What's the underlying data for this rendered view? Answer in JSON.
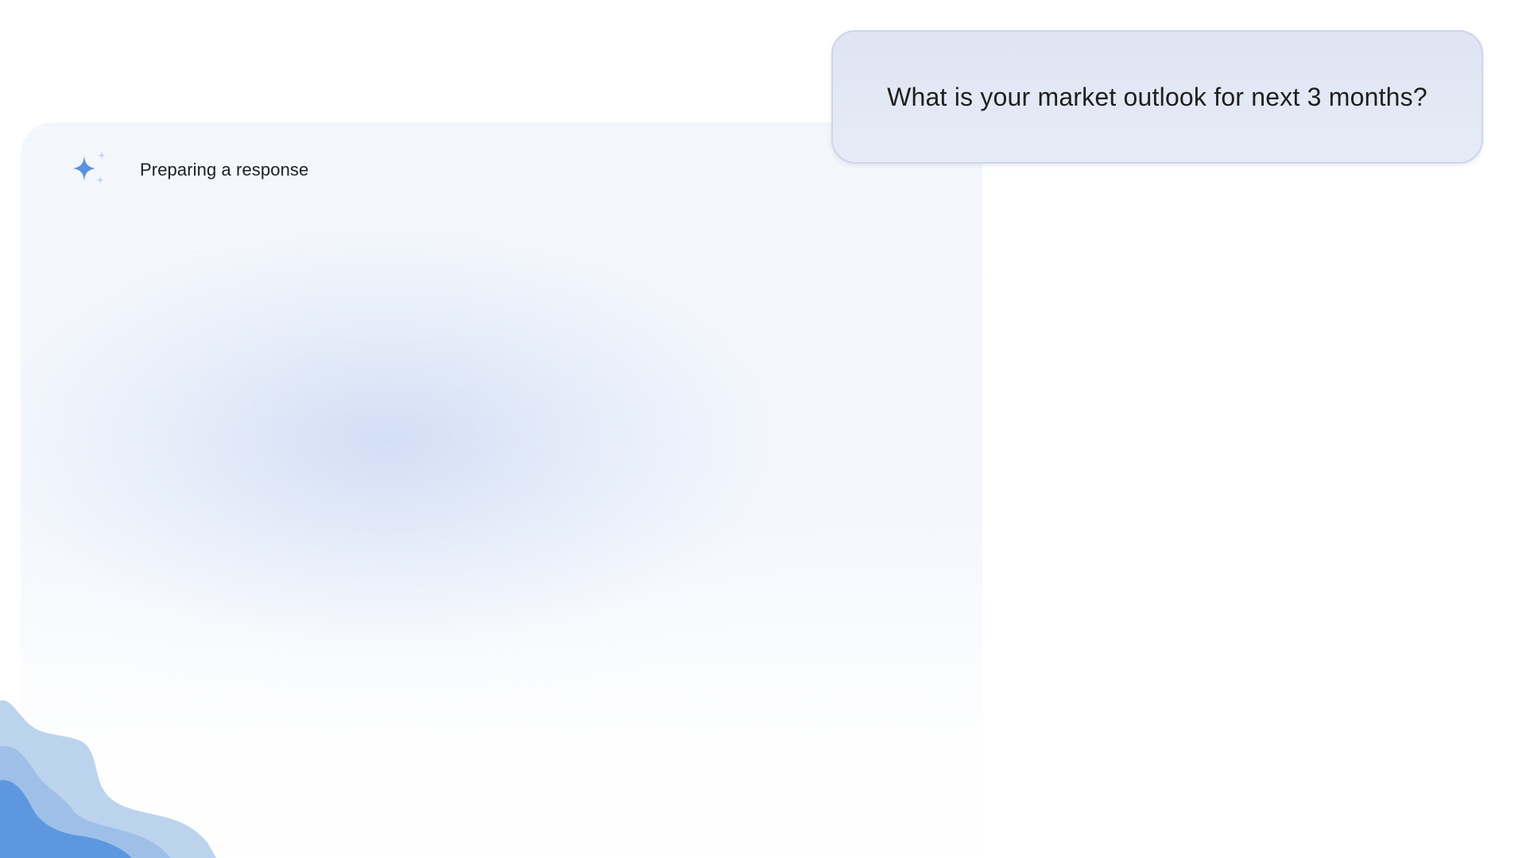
{
  "conversation": {
    "user_message": "What is your market outlook for next 3 months?",
    "assistant_status": "Preparing a response"
  },
  "icons": {
    "status": "sparkle-icon",
    "decoration": "wave-decoration"
  },
  "colors": {
    "bubble_background": "#e3e8f5",
    "bubble_border": "#cdd5ea",
    "sparkle_primary": "#5b8fe0",
    "sparkle_secondary": "#c7d6f2",
    "wave_light": "#bcd3ee",
    "wave_mid": "#9ec0e8",
    "wave_dark": "#5d97e0",
    "text": "#1f1f1f"
  }
}
